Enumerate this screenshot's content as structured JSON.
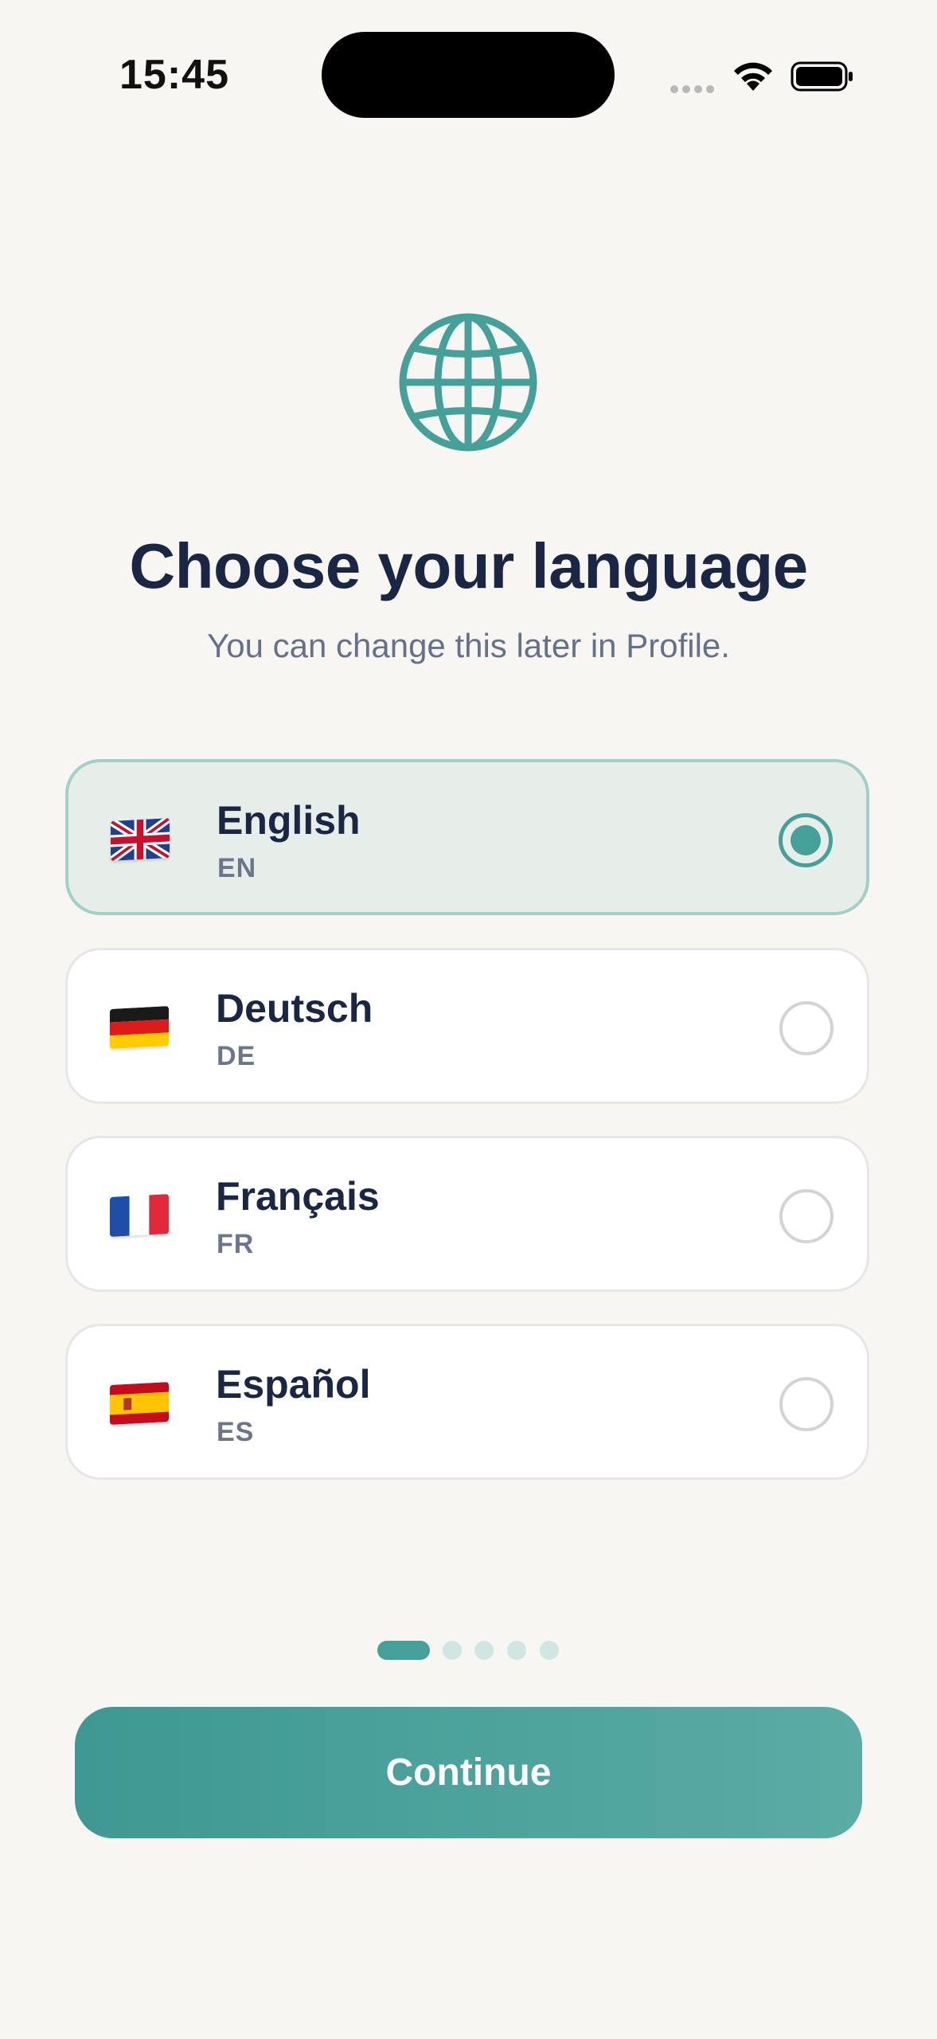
{
  "status_bar": {
    "time": "15:45"
  },
  "header": {
    "icon": "globe-icon",
    "title": "Choose your language",
    "subtitle": "You can change this later in Profile."
  },
  "languages": [
    {
      "name": "English",
      "code": "EN",
      "flag": "uk-flag-icon",
      "selected": true
    },
    {
      "name": "Deutsch",
      "code": "DE",
      "flag": "germany-flag-icon",
      "selected": false
    },
    {
      "name": "Français",
      "code": "FR",
      "flag": "france-flag-icon",
      "selected": false
    },
    {
      "name": "Español",
      "code": "ES",
      "flag": "spain-flag-icon",
      "selected": false
    }
  ],
  "pager": {
    "total": 5,
    "current": 1
  },
  "continue_label": "Continue",
  "colors": {
    "accent": "#45a09a",
    "title": "#1a2744",
    "subtitle": "#65708a",
    "background": "#f7f6f3",
    "selected_background": "#e7eeea"
  }
}
